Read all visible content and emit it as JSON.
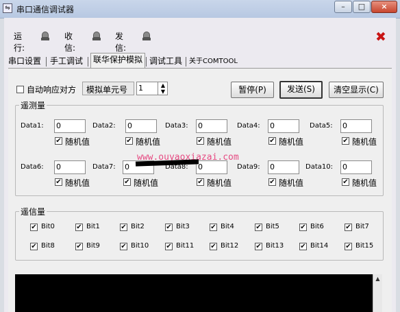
{
  "window": {
    "title": "串口通信调试器",
    "app_icon": "serial-port-icon",
    "buttons": {
      "minimize": "–",
      "maximize": "□",
      "close": "×"
    }
  },
  "status": {
    "run_label": "运行:",
    "recv_label": "收信:",
    "send_label": "发信:",
    "lamp_icon": "alarm-lamp-icon",
    "close_glyph": "✖",
    "close_color": "#c81414"
  },
  "tabs": [
    {
      "label": "串口设置",
      "active": false
    },
    {
      "label": "手工调试",
      "active": false
    },
    {
      "label": "联华保护模拟",
      "active": true
    },
    {
      "label": "调试工具",
      "active": false
    },
    {
      "label": "关于COMTOOL",
      "active": false
    }
  ],
  "controls": {
    "auto_reply_label": "自动响应对方",
    "auto_reply_checked": false,
    "unit_label": "模拟单元号",
    "unit_value": "1",
    "pause_button": "暂停(P)",
    "send_button": "发送(S)",
    "clear_button": "清空显示(C)"
  },
  "telemetry": {
    "title": "遥测量",
    "random_label": "随机值",
    "items": [
      {
        "label": "Data1:",
        "value": "0",
        "random": true
      },
      {
        "label": "Data2:",
        "value": "0",
        "random": true
      },
      {
        "label": "Data3:",
        "value": "0",
        "random": true
      },
      {
        "label": "Data4:",
        "value": "0",
        "random": true
      },
      {
        "label": "Data5:",
        "value": "0",
        "random": true
      },
      {
        "label": "Data6:",
        "value": "0",
        "random": true
      },
      {
        "label": "Data7:",
        "value": "0",
        "random": true
      },
      {
        "label": "Data8:",
        "value": "0",
        "random": true
      },
      {
        "label": "Data9:",
        "value": "0",
        "random": true
      },
      {
        "label": "Data10:",
        "value": "0",
        "random": true
      }
    ]
  },
  "telesignal": {
    "title": "遥信量",
    "bits": [
      {
        "label": "Bit0",
        "checked": true
      },
      {
        "label": "Bit1",
        "checked": true
      },
      {
        "label": "Bit2",
        "checked": true
      },
      {
        "label": "Bit3",
        "checked": true
      },
      {
        "label": "Bit4",
        "checked": true
      },
      {
        "label": "Bit5",
        "checked": true
      },
      {
        "label": "Bit6",
        "checked": true
      },
      {
        "label": "Bit7",
        "checked": true
      },
      {
        "label": "Bit8",
        "checked": true
      },
      {
        "label": "Bit9",
        "checked": true
      },
      {
        "label": "Bit10",
        "checked": true
      },
      {
        "label": "Bit11",
        "checked": true
      },
      {
        "label": "Bit12",
        "checked": true
      },
      {
        "label": "Bit13",
        "checked": true
      },
      {
        "label": "Bit14",
        "checked": true
      },
      {
        "label": "Bit15",
        "checked": true
      }
    ]
  },
  "watermark": "www.ouyaoxiazai.com"
}
